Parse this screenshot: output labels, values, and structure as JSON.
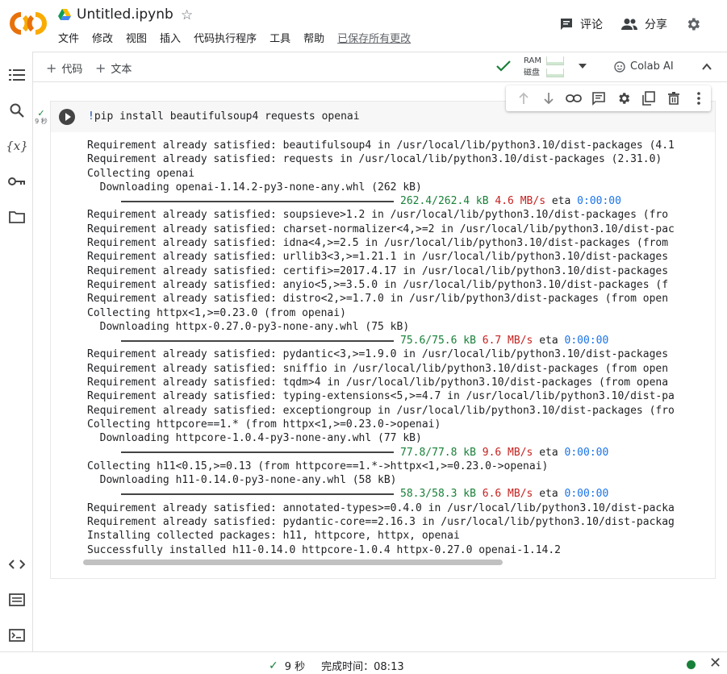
{
  "header": {
    "title": "Untitled.ipynb",
    "menu": [
      "文件",
      "修改",
      "视图",
      "插入",
      "代码执行程序",
      "工具",
      "帮助"
    ],
    "saved_status": "已保存所有更改",
    "comment_label": "评论",
    "share_label": "分享"
  },
  "toolbar": {
    "add_code": "代码",
    "add_text": "文本",
    "ram_label": "RAM",
    "disk_label": "磁盘",
    "colab_ai": "Colab AI"
  },
  "cell": {
    "code": "pip install beautifulsoup4 requests openai",
    "code_prefix": "!",
    "exec_time": "9 秒",
    "output": [
      {
        "type": "text",
        "text": "Requirement already satisfied: beautifulsoup4 in /usr/local/lib/python3.10/dist-packages (4.1"
      },
      {
        "type": "text",
        "text": "Requirement already satisfied: requests in /usr/local/lib/python3.10/dist-packages (2.31.0)"
      },
      {
        "type": "text",
        "text": "Collecting openai"
      },
      {
        "type": "text",
        "text": "  Downloading openai-1.14.2-py3-none-any.whl (262 kB)"
      },
      {
        "type": "progress",
        "size": "262.4/262.4 kB",
        "speed": "4.6 MB/s",
        "eta_label": "eta",
        "eta": "0:00:00"
      },
      {
        "type": "text",
        "text": "Requirement already satisfied: soupsieve>1.2 in /usr/local/lib/python3.10/dist-packages (fro"
      },
      {
        "type": "text",
        "text": "Requirement already satisfied: charset-normalizer<4,>=2 in /usr/local/lib/python3.10/dist-pac"
      },
      {
        "type": "text",
        "text": "Requirement already satisfied: idna<4,>=2.5 in /usr/local/lib/python3.10/dist-packages (from"
      },
      {
        "type": "text",
        "text": "Requirement already satisfied: urllib3<3,>=1.21.1 in /usr/local/lib/python3.10/dist-packages"
      },
      {
        "type": "text",
        "text": "Requirement already satisfied: certifi>=2017.4.17 in /usr/local/lib/python3.10/dist-packages"
      },
      {
        "type": "text",
        "text": "Requirement already satisfied: anyio<5,>=3.5.0 in /usr/local/lib/python3.10/dist-packages (f"
      },
      {
        "type": "text",
        "text": "Requirement already satisfied: distro<2,>=1.7.0 in /usr/lib/python3/dist-packages (from open"
      },
      {
        "type": "text",
        "text": "Collecting httpx<1,>=0.23.0 (from openai)"
      },
      {
        "type": "text",
        "text": "  Downloading httpx-0.27.0-py3-none-any.whl (75 kB)"
      },
      {
        "type": "progress",
        "size": "75.6/75.6 kB",
        "speed": "6.7 MB/s",
        "eta_label": "eta",
        "eta": "0:00:00"
      },
      {
        "type": "text",
        "text": "Requirement already satisfied: pydantic<3,>=1.9.0 in /usr/local/lib/python3.10/dist-packages"
      },
      {
        "type": "text",
        "text": "Requirement already satisfied: sniffio in /usr/local/lib/python3.10/dist-packages (from open"
      },
      {
        "type": "text",
        "text": "Requirement already satisfied: tqdm>4 in /usr/local/lib/python3.10/dist-packages (from opena"
      },
      {
        "type": "text",
        "text": "Requirement already satisfied: typing-extensions<5,>=4.7 in /usr/local/lib/python3.10/dist-pa"
      },
      {
        "type": "text",
        "text": "Requirement already satisfied: exceptiongroup in /usr/local/lib/python3.10/dist-packages (fro"
      },
      {
        "type": "text",
        "text": "Collecting httpcore==1.* (from httpx<1,>=0.23.0->openai)"
      },
      {
        "type": "text",
        "text": "  Downloading httpcore-1.0.4-py3-none-any.whl (77 kB)"
      },
      {
        "type": "progress",
        "size": "77.8/77.8 kB",
        "speed": "9.6 MB/s",
        "eta_label": "eta",
        "eta": "0:00:00"
      },
      {
        "type": "text",
        "text": "Collecting h11<0.15,>=0.13 (from httpcore==1.*->httpx<1,>=0.23.0->openai)"
      },
      {
        "type": "text",
        "text": "  Downloading h11-0.14.0-py3-none-any.whl (58 kB)"
      },
      {
        "type": "progress",
        "size": "58.3/58.3 kB",
        "speed": "6.6 MB/s",
        "eta_label": "eta",
        "eta": "0:00:00"
      },
      {
        "type": "text",
        "text": "Requirement already satisfied: annotated-types>=0.4.0 in /usr/local/lib/python3.10/dist-packa"
      },
      {
        "type": "text",
        "text": "Requirement already satisfied: pydantic-core==2.16.3 in /usr/local/lib/python3.10/dist-packag"
      },
      {
        "type": "text",
        "text": "Installing collected packages: h11, httpcore, httpx, openai"
      },
      {
        "type": "text",
        "text": "Successfully installed h11-0.14.0 httpcore-1.0.4 httpx-0.27.0 openai-1.14.2"
      }
    ]
  },
  "statusbar": {
    "duration": "9 秒",
    "completed_label": "完成时间：08:13"
  },
  "icons": {
    "logo": "colab-logo-icon",
    "drive": "google-drive-icon",
    "star": "star-icon"
  },
  "colors": {
    "accent_green": "#188038",
    "logo_orange": "#f9ab00",
    "progress_red": "#c5221f",
    "eta_blue": "#1a73e8"
  }
}
